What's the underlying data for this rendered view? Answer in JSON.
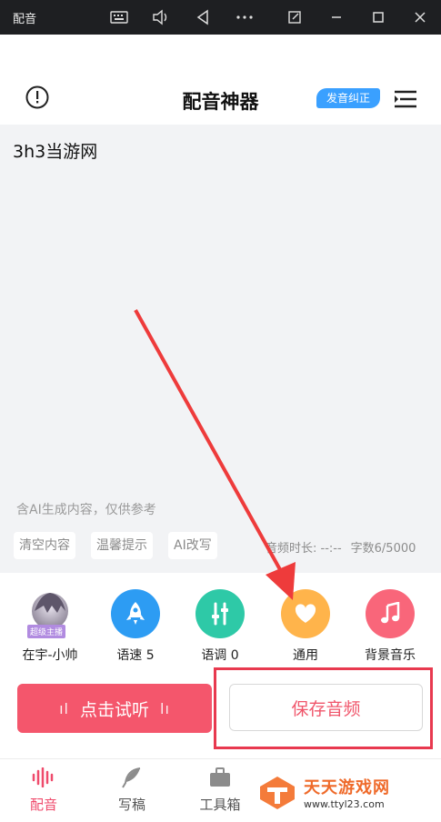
{
  "window": {
    "title": "配音"
  },
  "header": {
    "title": "配音神器",
    "badge": "发音纠正"
  },
  "editor": {
    "text": "3h3当游网",
    "ai_note": "含AI生成内容，仅供参考",
    "actions": [
      "清空内容",
      "温馨提示",
      "AI改写"
    ],
    "duration": "音频时长: --:--",
    "char_count": "字数6/5000"
  },
  "tools": [
    {
      "label": "在宇-小帅",
      "tag": "超级主播"
    },
    {
      "label": "语速 5"
    },
    {
      "label": "语调 0"
    },
    {
      "label": "通用"
    },
    {
      "label": "背景音乐"
    }
  ],
  "buttons": {
    "listen": "点击试听",
    "save": "保存音频"
  },
  "nav": [
    "配音",
    "写稿",
    "工具箱"
  ],
  "watermark": {
    "name": "天天游戏网",
    "url": "www.ttyl23.com"
  },
  "colors": {
    "accent": "#f4566c",
    "blue": "#2d9cf3",
    "teal": "#2ec9a7",
    "orange": "#ffb44b",
    "pink": "#f9667a",
    "badge": "#3aa0ff"
  }
}
